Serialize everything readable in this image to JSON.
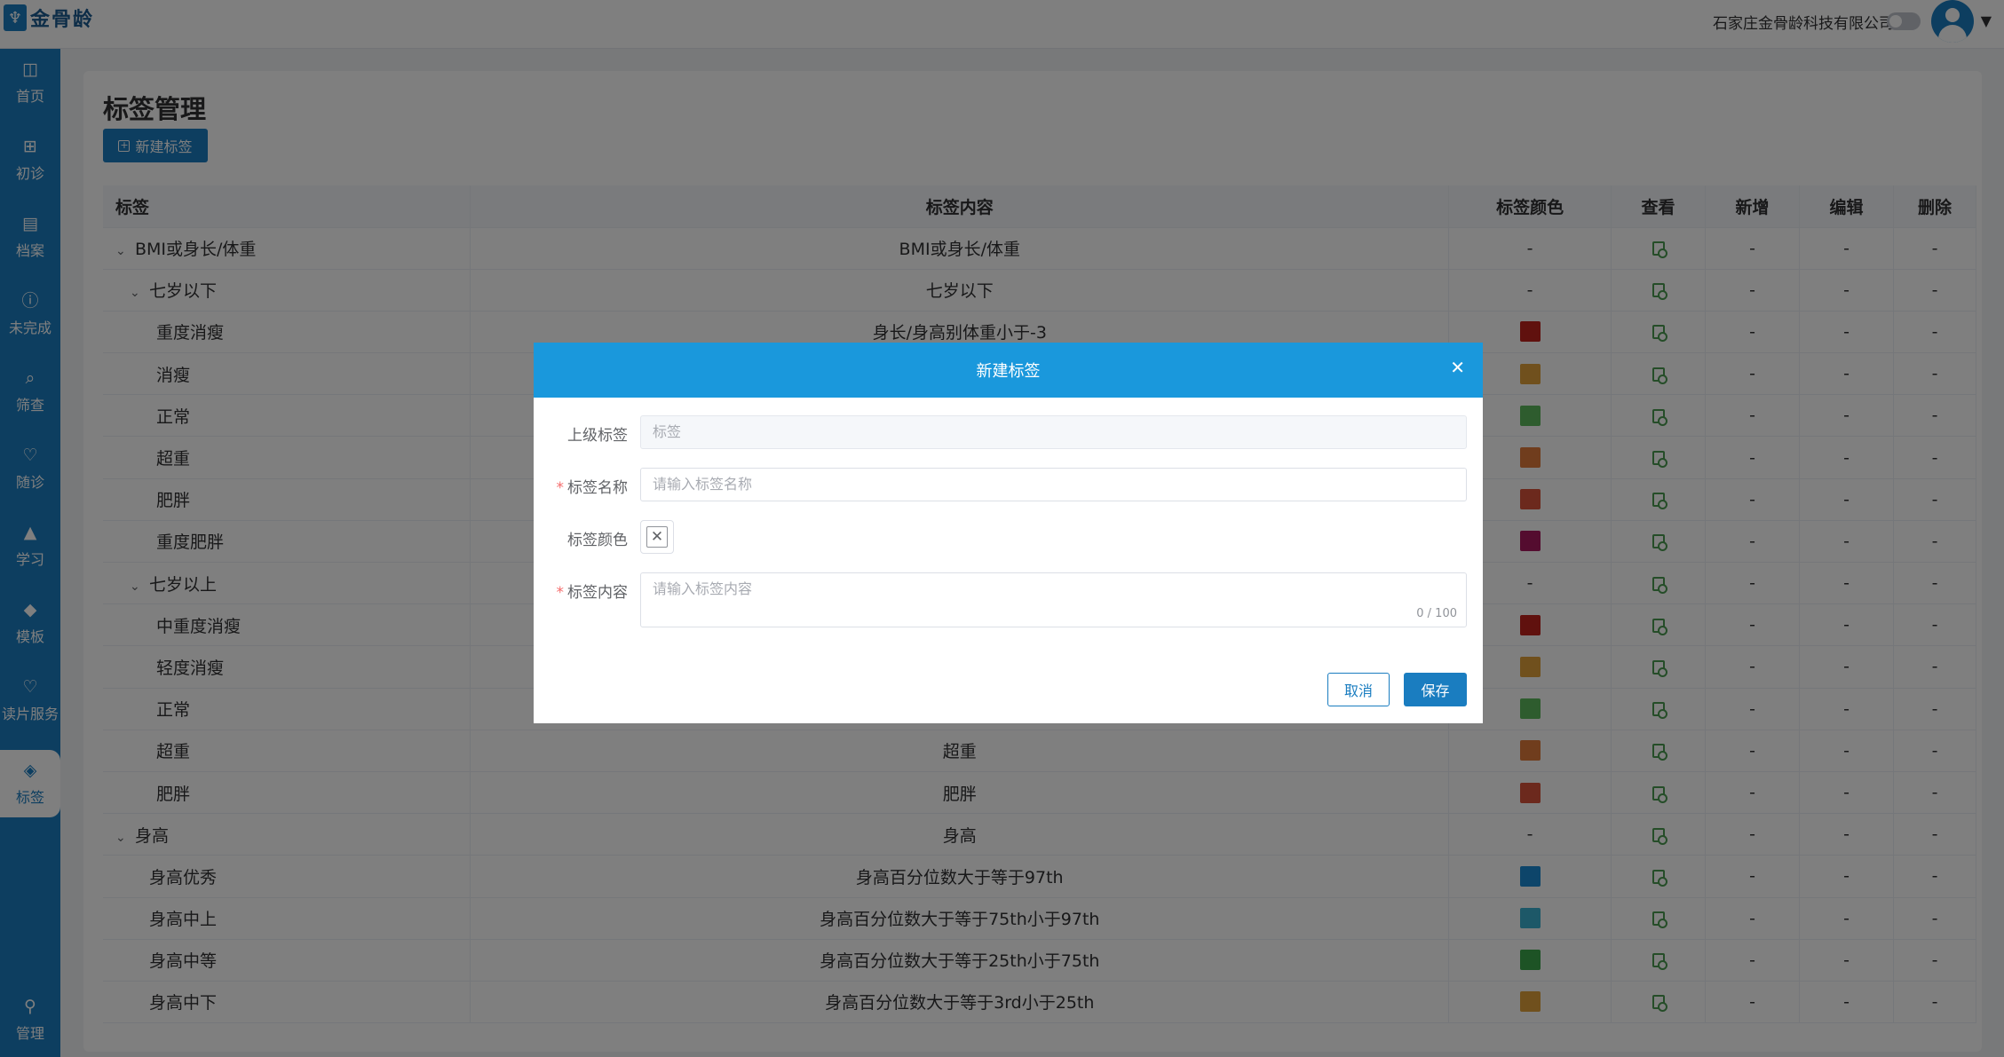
{
  "header": {
    "logo_text": "金骨龄",
    "company": "石家庄金骨龄科技有限公司"
  },
  "sidebar": {
    "items": [
      {
        "label": "首页",
        "icon": "dashboard-icon"
      },
      {
        "label": "初诊",
        "icon": "plus-box-icon"
      },
      {
        "label": "档案",
        "icon": "archive-icon"
      },
      {
        "label": "未完成",
        "icon": "info-icon"
      },
      {
        "label": "筛查",
        "icon": "search-doc-icon"
      },
      {
        "label": "随诊",
        "icon": "heart-icon"
      },
      {
        "label": "学习",
        "icon": "graduation-cap-icon"
      },
      {
        "label": "模板",
        "icon": "box-icon"
      },
      {
        "label": "读片服务",
        "icon": "heart-outline-icon"
      },
      {
        "label": "标签",
        "icon": "tag-icon",
        "active": true
      },
      {
        "label": "管理",
        "icon": "user-icon"
      }
    ]
  },
  "main": {
    "title": "标签管理",
    "new_button": "新建标签",
    "columns": [
      "标签",
      "标签内容",
      "标签颜色",
      "查看",
      "新增",
      "编辑",
      "删除"
    ],
    "dash": "-",
    "rows": [
      {
        "name": "BMI或身长/体重",
        "content": "BMI或身长/体重",
        "color": null,
        "level": 0,
        "expanded": true
      },
      {
        "name": "七岁以下",
        "content": "七岁以下",
        "color": null,
        "level": 1,
        "expanded": true
      },
      {
        "name": "重度消瘦",
        "content": "身长/身高别体重小于-3",
        "color": "#c0221d",
        "level": 2
      },
      {
        "name": "消瘦",
        "content": "",
        "color": "#e0a03a",
        "level": 2
      },
      {
        "name": "正常",
        "content": "",
        "color": "#5cb85c",
        "level": 2
      },
      {
        "name": "超重",
        "content": "",
        "color": "#e07a3a",
        "level": 2
      },
      {
        "name": "肥胖",
        "content": "",
        "color": "#d9533a",
        "level": 2
      },
      {
        "name": "重度肥胖",
        "content": "",
        "color": "#a8185e",
        "level": 2
      },
      {
        "name": "七岁以上",
        "content": "",
        "color": null,
        "level": 1,
        "expanded": true
      },
      {
        "name": "中重度消瘦",
        "content": "",
        "color": "#c0221d",
        "level": 2
      },
      {
        "name": "轻度消瘦",
        "content": "",
        "color": "#e0a03a",
        "level": 2
      },
      {
        "name": "正常",
        "content": "",
        "color": "#5cb85c",
        "level": 2
      },
      {
        "name": "超重",
        "content": "超重",
        "color": "#e07a3a",
        "level": 2
      },
      {
        "name": "肥胖",
        "content": "肥胖",
        "color": "#d9533a",
        "level": 2
      },
      {
        "name": "身高",
        "content": "身高",
        "color": null,
        "level": 0,
        "expanded": true
      },
      {
        "name": "身高优秀",
        "content": "身高百分位数大于等于97th",
        "color": "#1a8ad4",
        "level": 1
      },
      {
        "name": "身高中上",
        "content": "身高百分位数大于等于75th小于97th",
        "color": "#3ab0d0",
        "level": 1
      },
      {
        "name": "身高中等",
        "content": "身高百分位数大于等于25th小于75th",
        "color": "#3aa64a",
        "level": 1
      },
      {
        "name": "身高中下",
        "content": "身高百分位数大于等于3rd小于25th",
        "color": "#e0a03a",
        "level": 1
      }
    ]
  },
  "dialog": {
    "title": "新建标签",
    "parent_label": "上级标签",
    "parent_placeholder": "标签",
    "name_label": "标签名称",
    "name_placeholder": "请输入标签名称",
    "color_label": "标签颜色",
    "content_label": "标签内容",
    "content_placeholder": "请输入标签内容",
    "counter": "0 / 100",
    "cancel": "取消",
    "save": "保存"
  },
  "colors": {
    "brand": "#1a7dc0",
    "dialog_header": "#1a98dc",
    "required": "#f56c6c"
  }
}
